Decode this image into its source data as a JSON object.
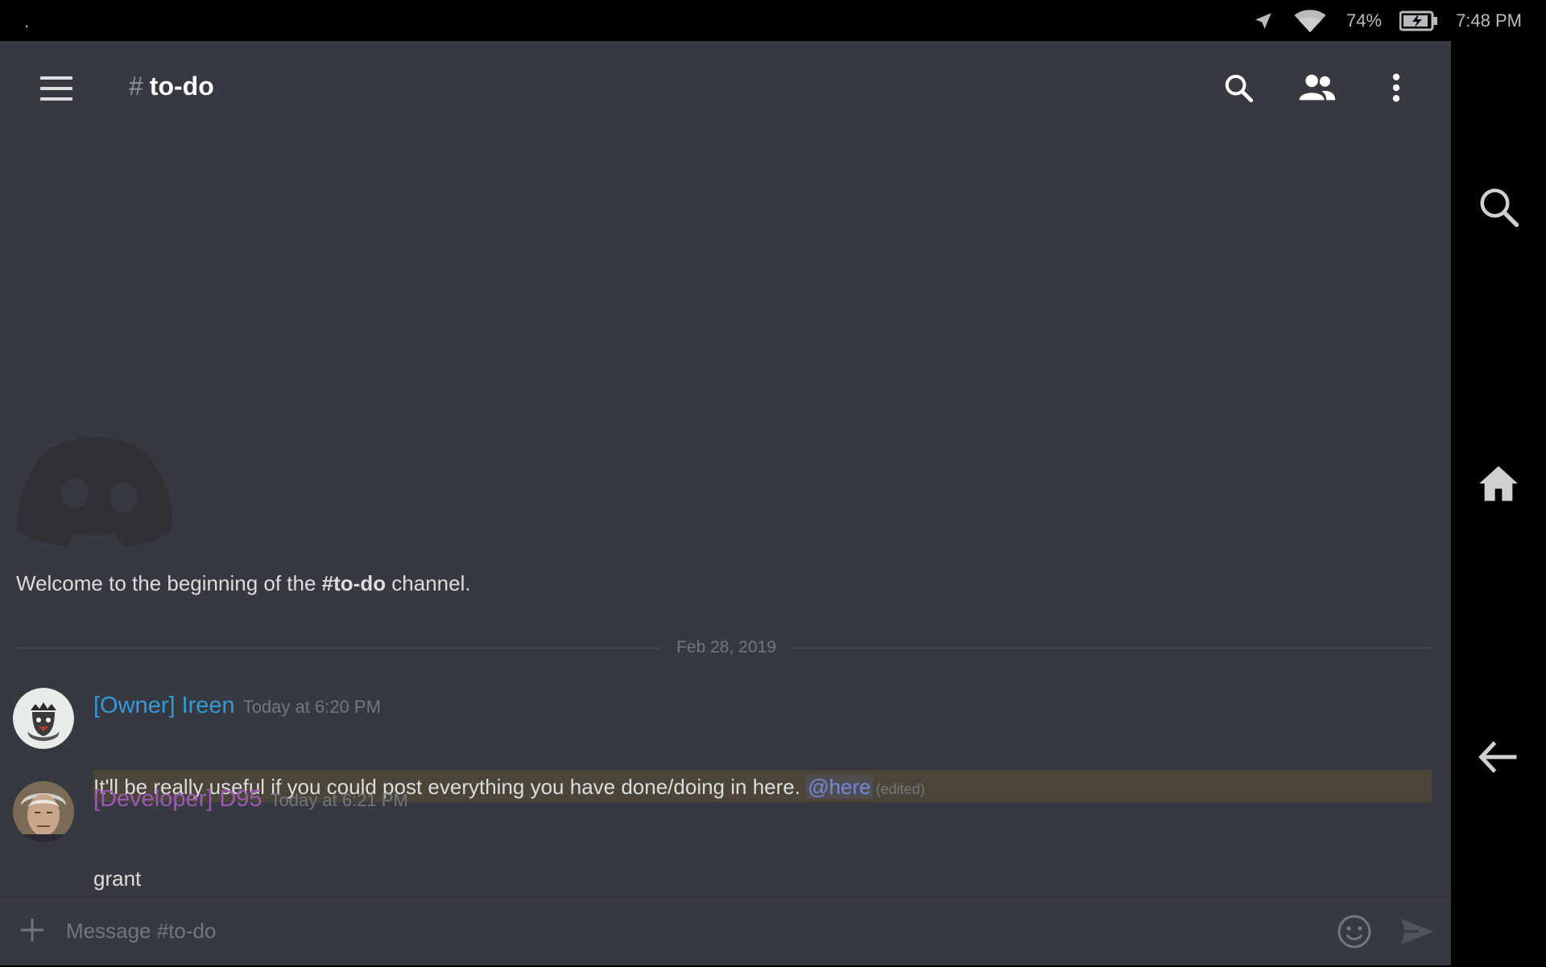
{
  "status_bar": {
    "notification_dot": ".",
    "battery_percent": "74%",
    "time": "7:48 PM",
    "icons": [
      "location-icon",
      "wifi-icon",
      "battery-charging-icon"
    ]
  },
  "header": {
    "hash": "#",
    "channel_name": "to-do",
    "actions": [
      "search-icon",
      "members-icon",
      "more-icon"
    ]
  },
  "welcome": {
    "prefix": "Welcome to the beginning of the ",
    "channel": "#to-do",
    "suffix": " channel."
  },
  "divider": {
    "date": "Feb 28, 2019"
  },
  "messages": [
    {
      "username": "[Owner] Ireen",
      "username_color": "#3498db",
      "timestamp": "Today at 6:20 PM",
      "text": "It'll be really useful if you could post everything you have done/doing in here. ",
      "mention": "@here",
      "edited": "(edited)"
    },
    {
      "username": "[Developer] D95",
      "username_color": "#9b59b6",
      "timestamp": "Today at 6:21 PM",
      "text": "grant"
    }
  ],
  "composer": {
    "placeholder": "Message #to-do"
  },
  "colors": {
    "background": "#36393f",
    "mention": "#7289da",
    "highlight": "#4a4439"
  }
}
